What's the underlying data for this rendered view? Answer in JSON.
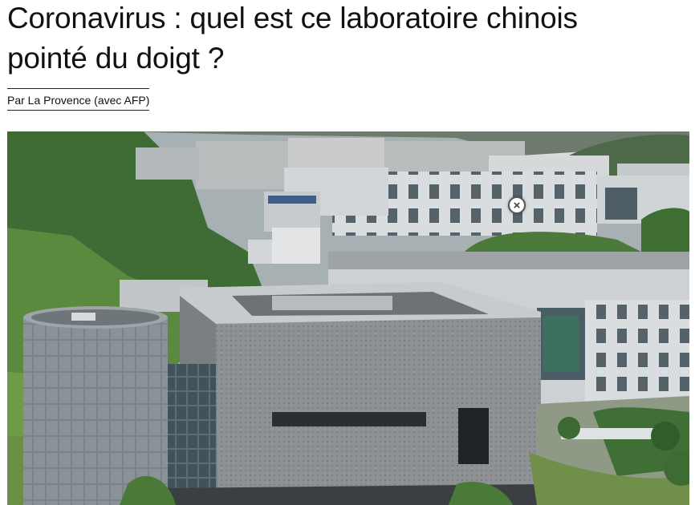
{
  "article": {
    "headline_line1": "Coronavirus : quel est ce laboratoire chinois",
    "headline_line2": "pointé du doigt ?",
    "byline": "Par La Provence (avec AFP)"
  },
  "photo": {
    "subject": "laboratory building aerial photograph",
    "close_icon": "close-icon",
    "close_glyph": "×"
  }
}
